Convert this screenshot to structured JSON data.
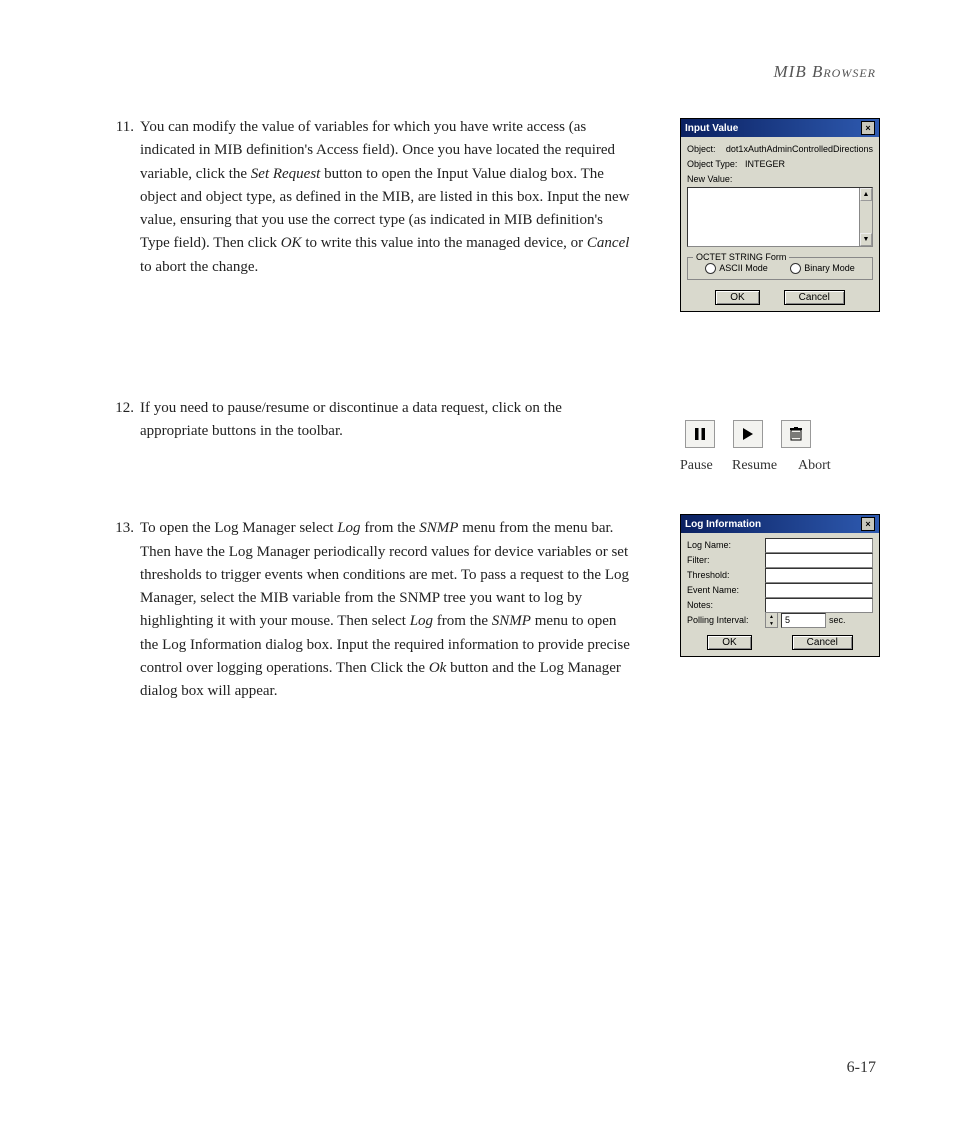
{
  "header": {
    "title": "MIB Browser"
  },
  "page_number": "6-17",
  "items": {
    "i11": {
      "num": "11.",
      "pre": "You can modify the value of variables for which you have write access (as indicated in MIB definition's Access field). Once you have located the required variable, click the ",
      "em1": "Set Request",
      "mid1": " button to open the Input Value dialog box. The object and object type, as defined in the MIB, are listed in this box. Input the new value, ensuring that you use the correct type (as indicated in MIB definition's Type field). Then click ",
      "em2": "OK",
      "mid2": " to write this value into the managed device, or ",
      "em3": "Cancel",
      "post": " to abort the change."
    },
    "i12": {
      "num": "12.",
      "text": "If you need to pause/resume or discontinue a data request, click on the appropriate buttons in the toolbar."
    },
    "i13": {
      "num": "13.",
      "pre": "To open the Log Manager select ",
      "em1": "Log",
      "mid1": " from the ",
      "em2": "SNMP",
      "mid2": " menu from the menu bar. Then have the Log Manager periodically record values for device variables or set thresholds to trigger events when conditions are met. To pass a request to the Log Manager, select the MIB variable from the SNMP tree you want to log by highlighting it with your mouse. Then select ",
      "em3": "Log",
      "mid3": " from the ",
      "em4": "SNMP",
      "mid4": " menu to open the Log Information dialog box. Input the required information to provide precise control over logging operations. Then Click the ",
      "em5": "Ok",
      "post": " button and the Log Manager dialog box will appear."
    }
  },
  "input_value_dialog": {
    "title": "Input Value",
    "object_label": "Object:",
    "object_value": "dot1xAuthAdminControlledDirections",
    "type_label": "Object Type:",
    "type_value": "INTEGER",
    "new_value_label": "New Value:",
    "group_title": "OCTET STRING Form",
    "ascii": "ASCII Mode",
    "binary": "Binary Mode",
    "ok": "OK",
    "cancel": "Cancel"
  },
  "toolbar": {
    "pause_label": "Pause",
    "resume_label": "Resume",
    "abort_label": "Abort"
  },
  "log_dialog": {
    "title": "Log Information",
    "log_name": "Log Name:",
    "filter": "Filter:",
    "threshold": "Threshold:",
    "event_name": "Event Name:",
    "notes": "Notes:",
    "polling": "Polling Interval:",
    "polling_value": "5",
    "sec": "sec.",
    "ok": "OK",
    "cancel": "Cancel"
  }
}
